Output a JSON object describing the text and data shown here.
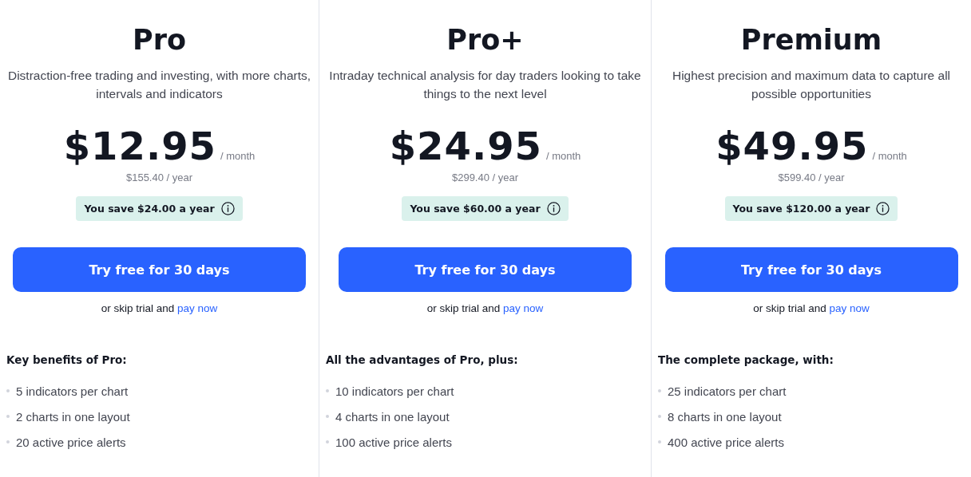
{
  "plans": [
    {
      "name": "Pro",
      "description": "Distraction-free trading and investing, with more charts, intervals and indicators",
      "price": "$12.95",
      "period": "/ month",
      "yearly": "$155.40 / year",
      "savings": "You save $24.00 a year",
      "cta": "Try free for 30 days",
      "skip_text": "or skip trial and",
      "pay_link": "pay now",
      "benefits_heading": "Key benefits of Pro:",
      "benefits": [
        "5 indicators per chart",
        "2 charts in one layout",
        "20 active price alerts"
      ]
    },
    {
      "name": "Pro+",
      "description": "Intraday technical analysis for day traders looking to take things to the next level",
      "price": "$24.95",
      "period": "/ month",
      "yearly": "$299.40 / year",
      "savings": "You save $60.00 a year",
      "cta": "Try free for 30 days",
      "skip_text": "or skip trial and",
      "pay_link": "pay now",
      "benefits_heading": "All the advantages of Pro, plus:",
      "benefits": [
        "10 indicators per chart",
        "4 charts in one layout",
        "100 active price alerts"
      ]
    },
    {
      "name": "Premium",
      "description": "Highest precision and maximum data to capture all possible opportunities",
      "price": "$49.95",
      "period": "/ month",
      "yearly": "$599.40 / year",
      "savings": "You save $120.00 a year",
      "cta": "Try free for 30 days",
      "skip_text": "or skip trial and",
      "pay_link": "pay now",
      "benefits_heading": "The complete package, with:",
      "benefits": [
        "25 indicators per chart",
        "8 charts in one layout",
        "400 active price alerts"
      ]
    }
  ]
}
